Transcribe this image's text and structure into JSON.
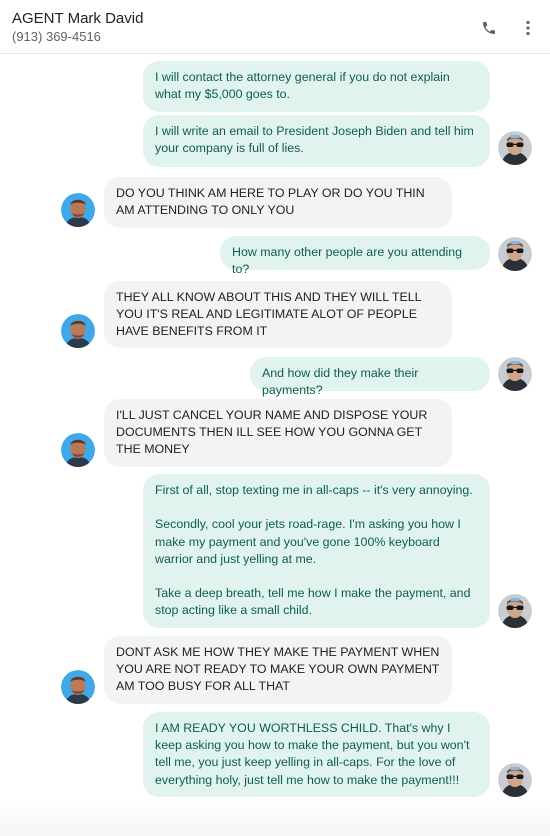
{
  "header": {
    "contact_name": "AGENT Mark David",
    "contact_phone": "(913) 369-4516",
    "call_icon": "phone-icon",
    "more_icon": "more-vert-icon"
  },
  "messages": [
    {
      "sender": "me",
      "text": "I will contact the attorney general if you do not explain what my $5,000 goes to."
    },
    {
      "sender": "me",
      "text": "I will write an email to President Joseph Biden and tell him your company is full of lies."
    },
    {
      "sender": "agent",
      "text": "DO YOU THINK AM HERE TO PLAY OR DO YOU THIN AM ATTENDING TO ONLY YOU"
    },
    {
      "sender": "me",
      "text": "How many other people are you attending to?"
    },
    {
      "sender": "agent",
      "text": "THEY ALL KNOW ABOUT THIS AND THEY WILL TELL YOU IT'S REAL AND LEGITIMATE ALOT OF PEOPLE HAVE BENEFITS FROM IT"
    },
    {
      "sender": "me",
      "text": "And how did they make their payments?"
    },
    {
      "sender": "agent",
      "text": "I'LL JUST CANCEL YOUR NAME AND DISPOSE YOUR DOCUMENTS THEN ILL SEE HOW YOU GONNA GET THE MONEY"
    },
    {
      "sender": "me",
      "text": "First of all, stop texting me in all-caps -- it's very annoying.\n\nSecondly, cool your jets road-rage. I'm asking you how I make my payment and you've gone 100% keyboard warrior and just yelling at me.\n\nTake a deep breath, tell me how I make the payment, and stop acting like a small child."
    },
    {
      "sender": "agent",
      "text": "DONT ASK ME HOW THEY MAKE THE PAYMENT WHEN YOU ARE NOT READY TO MAKE YOUR OWN PAYMENT AM TOO BUSY FOR ALL THAT"
    },
    {
      "sender": "me",
      "text": "I AM READY YOU WORTHLESS CHILD. That's why I keep asking you how to make the payment, but you won't tell me, you just keep yelling in all-caps. For the love of everything holy, just tell me how to make the payment!!!"
    }
  ],
  "colors": {
    "outgoing_bubble": "#e1f3ef",
    "outgoing_text": "#0d5e4c",
    "incoming_bubble": "#f1f3f4",
    "incoming_text": "#202124"
  }
}
